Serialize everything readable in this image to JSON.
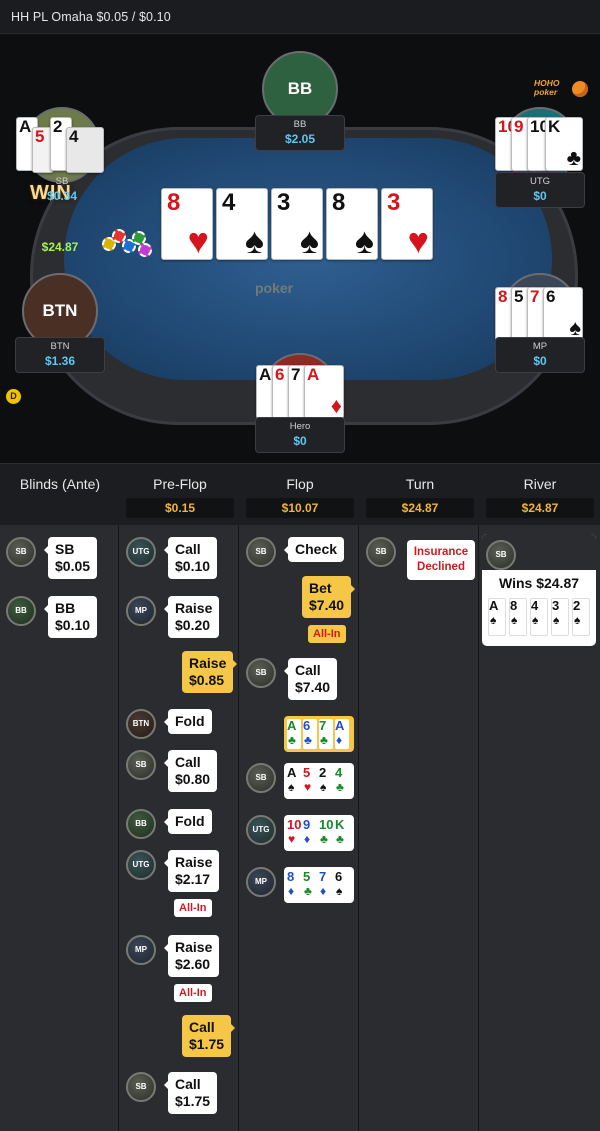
{
  "header": {
    "title": "HH PL Omaha $0.05 / $0.10"
  },
  "brand": {
    "line1": "HOHO",
    "line2": "poker"
  },
  "felt_logo": "poker",
  "seats": {
    "bb": {
      "avatar": "BB",
      "name": "BB",
      "stack": "$2.05"
    },
    "sb": {
      "name": "SB",
      "stack": "$0.34",
      "won": "$24.87",
      "win_label": "WIN"
    },
    "utg": {
      "name": "UTG",
      "stack": "$0"
    },
    "btn": {
      "avatar": "BTN",
      "name": "BTN",
      "stack": "$1.36",
      "dealer": "D"
    },
    "mp": {
      "name": "MP",
      "stack": "$0"
    },
    "hero": {
      "name": "Hero",
      "stack": "$0"
    }
  },
  "board": [
    {
      "rank": "8",
      "suit": "♥",
      "color": "red"
    },
    {
      "rank": "4",
      "suit": "♠",
      "color": "blk"
    },
    {
      "rank": "3",
      "suit": "♠",
      "color": "blk"
    },
    {
      "rank": "8",
      "suit": "♠",
      "color": "blk"
    },
    {
      "rank": "3",
      "suit": "♥",
      "color": "red"
    }
  ],
  "streets": [
    {
      "name": "Blinds (Ante)",
      "pot": ""
    },
    {
      "name": "Pre-Flop",
      "pot": "$0.15"
    },
    {
      "name": "Flop",
      "pot": "$10.07"
    },
    {
      "name": "Turn",
      "pot": "$24.87"
    },
    {
      "name": "River",
      "pot": "$24.87"
    }
  ],
  "actions": {
    "blinds": [
      {
        "pos": "SB",
        "line1": "SB",
        "line2": "$0.05"
      },
      {
        "pos": "BB",
        "line1": "BB",
        "line2": "$0.10"
      }
    ],
    "preflop": [
      {
        "pos": "UTG",
        "line1": "Call",
        "line2": "$0.10"
      },
      {
        "pos": "MP",
        "line1": "Raise",
        "line2": "$0.20"
      },
      {
        "pos": "",
        "line1": "Raise",
        "line2": "$0.85"
      },
      {
        "pos": "BTN",
        "line1": "Fold",
        "line2": ""
      },
      {
        "pos": "SB",
        "line1": "Call",
        "line2": "$0.80"
      },
      {
        "pos": "BB",
        "line1": "Fold",
        "line2": ""
      },
      {
        "pos": "UTG",
        "line1": "Raise",
        "line2": "$2.17",
        "tag": "All-In"
      },
      {
        "pos": "MP",
        "line1": "Raise",
        "line2": "$2.60",
        "tag": "All-In"
      },
      {
        "pos": "",
        "line1": "Call",
        "line2": "$1.75"
      },
      {
        "pos": "SB",
        "line1": "Call",
        "line2": "$1.75"
      }
    ],
    "flop": [
      {
        "pos": "SB",
        "line1": "Check"
      },
      {
        "pos": "",
        "line1": "Bet",
        "line2": "$7.40",
        "tag": "All-In"
      },
      {
        "pos": "SB",
        "line1": "Call",
        "line2": "$7.40"
      }
    ],
    "turn": {
      "pos": "SB",
      "line1": "Insurance",
      "line2": "Declined"
    },
    "river": {
      "pos": "SB",
      "result": "Wins $24.87"
    }
  },
  "icon_names": [
    "chip-stack-icon",
    "dealer-button-icon",
    "hoho-poker-logo"
  ],
  "colors": {
    "stack": "#5ec8f2",
    "pot": "#f2b43a",
    "accent": "#f6c646",
    "allin": "#c81d24"
  }
}
